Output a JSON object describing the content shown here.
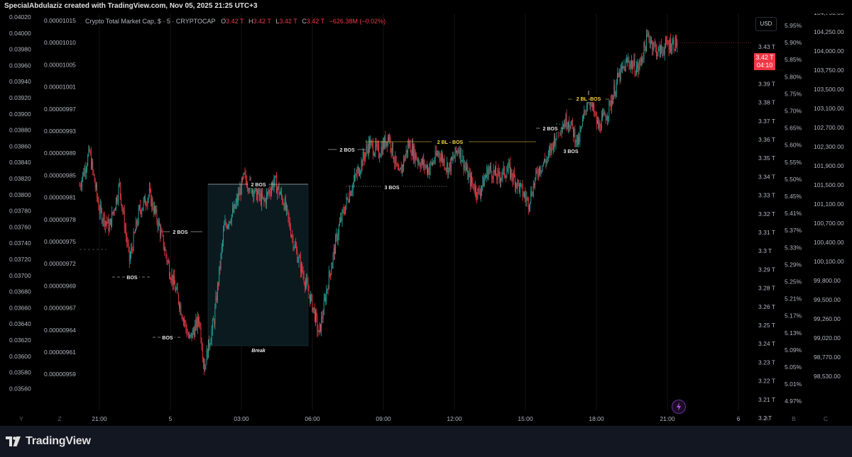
{
  "header": {
    "caption": "SpecialAbdulaziz created with TradingView.com, Nov 05, 2025 21:25 UTC+3"
  },
  "legend": {
    "symbol": "Crypto Total Market Cap, $ · 5 · CRYPTOCAP",
    "open_label": "O",
    "open_value": "3.42 T",
    "high_label": "H",
    "high_value": "3.42 T",
    "low_label": "L",
    "low_value": "3.42 T",
    "close_label": "C",
    "close_value": "3.42 T",
    "change": "−626.38M (−0.02%)"
  },
  "currency_button": "USD",
  "last_price": {
    "value": "3.42 T",
    "countdown": "04:10"
  },
  "footer": {
    "brand": "TradingView"
  },
  "axis_buttons": {
    "y": "Y",
    "z": "Z",
    "a": "A",
    "b": "B",
    "c": "C"
  },
  "colors": {
    "up": "#26a69a",
    "down": "#f23645",
    "background": "#000000",
    "annotation": "#e8e8e8",
    "annotation_highlight": "#f5d742",
    "zone_fill": "#0b1a1f"
  },
  "chart_data": {
    "type": "candlestick",
    "x_ticks": [
      "21:00",
      "5",
      "03:00",
      "06:00",
      "09:00",
      "12:00",
      "15:00",
      "18:00",
      "21:00",
      "6"
    ],
    "left_axis_1": [
      "0.04020",
      "0.04000",
      "0.03980",
      "0.03960",
      "0.03940",
      "0.03920",
      "0.03900",
      "0.03880",
      "0.03860",
      "0.03840",
      "0.03820",
      "0.03800",
      "0.03780",
      "0.03760",
      "0.03740",
      "0.03720",
      "0.03700",
      "0.03680",
      "0.03660",
      "0.03640",
      "0.03620",
      "0.03600",
      "0.03580",
      "0.03560"
    ],
    "left_axis_2": [
      "0.00001015",
      "0.00001010",
      "0.00001005",
      "0.00001001",
      "0.00000997",
      "0.00000993",
      "0.00000989",
      "0.00000985",
      "0.00000981",
      "0.00000978",
      "0.00000975",
      "0.00000972",
      "0.00000969",
      "0.00000967",
      "0.00000964",
      "0.00000961",
      "0.00000959"
    ],
    "right_axis_price": [
      "3.43 T",
      "3.41 T",
      "3.39 T",
      "3.38 T",
      "3.37 T",
      "3.36 T",
      "3.35 T",
      "3.34 T",
      "3.33 T",
      "3.32 T",
      "3.31 T",
      "3.3 T",
      "3.29 T",
      "3.28 T",
      "3.26 T",
      "3.25 T",
      "3.24 T",
      "3.23 T",
      "3.22 T",
      "3.21 T",
      "3.2 T"
    ],
    "right_axis_pct": [
      "5.95%",
      "5.90%",
      "5.85%",
      "5.80%",
      "5.75%",
      "5.70%",
      "5.65%",
      "5.60%",
      "5.55%",
      "5.50%",
      "5.45%",
      "5.41%",
      "5.37%",
      "5.33%",
      "5.29%",
      "5.25%",
      "5.21%",
      "5.17%",
      "5.13%",
      "5.09%",
      "5.05%",
      "5.01%",
      "4.97%"
    ],
    "right_axis_btc": [
      "104,750.00",
      "104,250.00",
      "104,000.00",
      "103,750.00",
      "103,500.00",
      "103,100.00",
      "102,700.00",
      "102,300.00",
      "101,900.00",
      "101,500.00",
      "101,100.00",
      "100,700.00",
      "100,400.00",
      "100,100.00",
      "99,800.00",
      "99,500.00",
      "99,260.00",
      "99,020.00",
      "98,770.00",
      "98,530.00"
    ],
    "price_range_T": [
      3.2,
      3.43
    ],
    "path_T": [
      [
        0,
        3.335
      ],
      [
        2,
        3.355
      ],
      [
        4,
        3.32
      ],
      [
        6,
        3.31
      ],
      [
        8,
        3.335
      ],
      [
        10,
        3.29
      ],
      [
        12,
        3.32
      ],
      [
        14,
        3.33
      ],
      [
        16,
        3.31
      ],
      [
        18,
        3.285
      ],
      [
        20,
        3.265
      ],
      [
        22,
        3.242
      ],
      [
        24,
        3.255
      ],
      [
        25,
        3.226
      ],
      [
        27,
        3.255
      ],
      [
        29,
        3.31
      ],
      [
        31,
        3.32
      ],
      [
        33,
        3.34
      ],
      [
        35,
        3.332
      ],
      [
        37,
        3.325
      ],
      [
        39,
        3.338
      ],
      [
        41,
        3.325
      ],
      [
        43,
        3.3
      ],
      [
        45,
        3.28
      ],
      [
        47,
        3.26
      ],
      [
        48,
        3.245
      ],
      [
        50,
        3.28
      ],
      [
        52,
        3.31
      ],
      [
        54,
        3.33
      ],
      [
        56,
        3.345
      ],
      [
        58,
        3.36
      ],
      [
        60,
        3.355
      ],
      [
        62,
        3.365
      ],
      [
        64,
        3.34
      ],
      [
        66,
        3.36
      ],
      [
        68,
        3.35
      ],
      [
        70,
        3.345
      ],
      [
        72,
        3.355
      ],
      [
        74,
        3.345
      ],
      [
        76,
        3.358
      ],
      [
        78,
        3.34
      ],
      [
        80,
        3.33
      ],
      [
        82,
        3.345
      ],
      [
        84,
        3.34
      ],
      [
        86,
        3.345
      ],
      [
        88,
        3.335
      ],
      [
        90,
        3.325
      ],
      [
        92,
        3.345
      ],
      [
        94,
        3.352
      ],
      [
        96,
        3.37
      ],
      [
        98,
        3.375
      ],
      [
        100,
        3.36
      ],
      [
        102,
        3.39
      ],
      [
        104,
        3.37
      ],
      [
        106,
        3.38
      ],
      [
        108,
        3.4
      ],
      [
        110,
        3.41
      ],
      [
        112,
        3.405
      ],
      [
        114,
        3.425
      ],
      [
        116,
        3.415
      ],
      [
        118,
        3.42
      ],
      [
        120,
        3.421
      ]
    ],
    "candle_count": 120,
    "annotations": [
      {
        "text": "BOS",
        "type": "dashed-level",
        "color": "#e8e8e8"
      },
      {
        "text": "2 BOS",
        "type": "level",
        "color": "#e8e8e8"
      },
      {
        "text": "BOS",
        "type": "dashed-level",
        "color": "#e8e8e8"
      },
      {
        "text": "2 BOS",
        "type": "level",
        "color": "#e8e8e8"
      },
      {
        "text": "Break",
        "type": "zone-label",
        "color": "#e8e8e8"
      },
      {
        "text": "2 BOS",
        "type": "level",
        "color": "#e8e8e8"
      },
      {
        "text": "3 BOS",
        "type": "dotted-level",
        "color": "#e8e8e8"
      },
      {
        "text": "2 BL - BOS",
        "type": "level",
        "color": "#f5d742"
      },
      {
        "text": "2 BOS",
        "type": "level",
        "color": "#e8e8e8"
      },
      {
        "text": "3 BOS",
        "type": "label",
        "color": "#e8e8e8"
      },
      {
        "text": "2 BL -BOS",
        "type": "level",
        "color": "#f5d742"
      }
    ]
  }
}
